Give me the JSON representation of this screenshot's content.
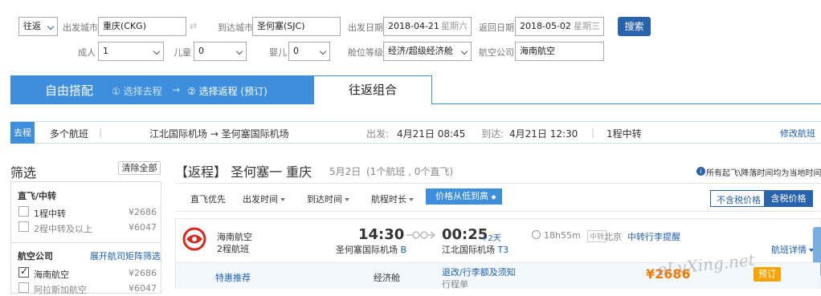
{
  "search": {
    "trip_type": "往返",
    "depart_city_label": "出发城市",
    "depart_city": "重庆(CKG)",
    "arrive_city_label": "到达城市",
    "arrive_city": "圣何塞(SJC)",
    "depart_date_label": "出发日期",
    "depart_date": "2018-04-21",
    "depart_weekday": "星期六",
    "return_date_label": "返回日期",
    "return_date": "2018-05-02",
    "return_weekday": "星期三",
    "search_button": "搜索",
    "adult_label": "成人",
    "adult_value": "1",
    "child_label": "儿童",
    "child_value": "0",
    "infant_label": "婴儿",
    "infant_value": "0",
    "cabin_label": "舱位等级",
    "cabin_value": "经济/超级经济舱",
    "airline_label": "航空公司",
    "airline_value": "海南航空"
  },
  "mode": {
    "free_combo": "自由搭配",
    "step1": "① 选择去程",
    "arrow": "→",
    "step2": "② 选择返程 (预订)",
    "round_combo": "往返组合"
  },
  "outbound": {
    "tag": "去程",
    "flights": "多个航班",
    "route": "江北国际机场 → 圣何塞国际机场",
    "depart_label": "出发:",
    "depart_time": "4月21日 08:45",
    "arrive_label": "到达:",
    "arrive_time": "4月21日 12:30",
    "transfer": "1程中转",
    "modify": "修改航班"
  },
  "sidebar": {
    "title": "筛选",
    "clear_all": "清除全部",
    "direct_title": "直飞/中转",
    "options": [
      {
        "label": "1程中转",
        "price": "¥2686"
      },
      {
        "label": "2程中转及以上",
        "price": "¥6047"
      }
    ],
    "airline_title": "航空公司",
    "codeshare": "展开航司矩阵筛选",
    "airlines": [
      {
        "label": "海南航空",
        "price": "¥2686"
      },
      {
        "label": "阿拉斯加航空",
        "price": "¥6047"
      }
    ]
  },
  "results": {
    "heading": "【返程】 圣何塞一 重庆",
    "date": "5月2日",
    "count": "(1个航班 , 0个直飞)",
    "timezone_note": "所有起飞\\降落时间均为当地时间",
    "sort": [
      "直飞优先",
      "出发时间",
      "到达时间",
      "航程时长",
      "价格从低到高"
    ],
    "price_toggle": [
      "不含税价格",
      "含税价格"
    ]
  },
  "flight": {
    "airline": "海南航空",
    "legs": "2程航班",
    "depart_time": "14:30",
    "depart_airport": "圣何塞国际机场",
    "depart_terminal": "B",
    "arrive_time": "00:25",
    "arrive_plus": "+2天",
    "arrive_airport": "江北国际机场",
    "arrive_terminal": "T3",
    "duration": "18h55m",
    "transit_tag": "中转",
    "transit_city": "北京",
    "baggage": "中转行李提醒",
    "details": "航班详情",
    "special": "特惠推荐",
    "cabin": "经济舱",
    "refund": "退改/行李额及须知",
    "itinerary": "行程单",
    "price": "¥2686",
    "book": "预订"
  },
  "watermark": "eLvXing.net"
}
